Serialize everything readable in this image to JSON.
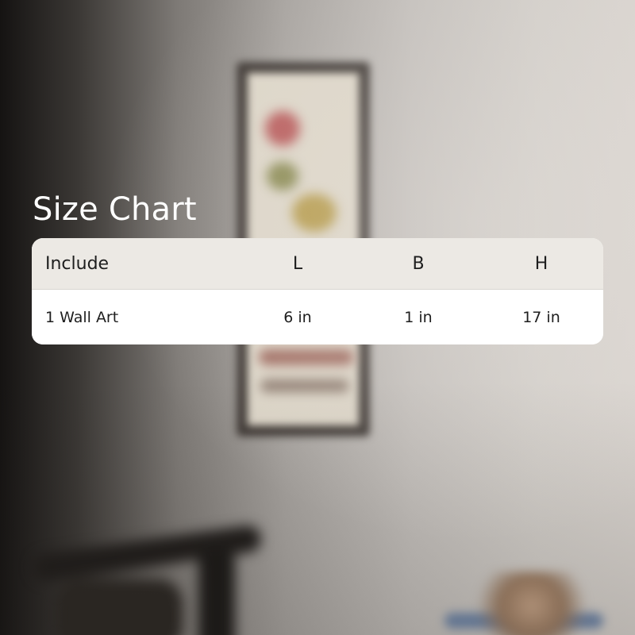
{
  "title": "Size Chart",
  "table": {
    "headers": [
      "Include",
      "L",
      "B",
      "H"
    ],
    "rows": [
      [
        "1 Wall Art",
        "6 in",
        "1 in",
        "17 in"
      ]
    ]
  }
}
